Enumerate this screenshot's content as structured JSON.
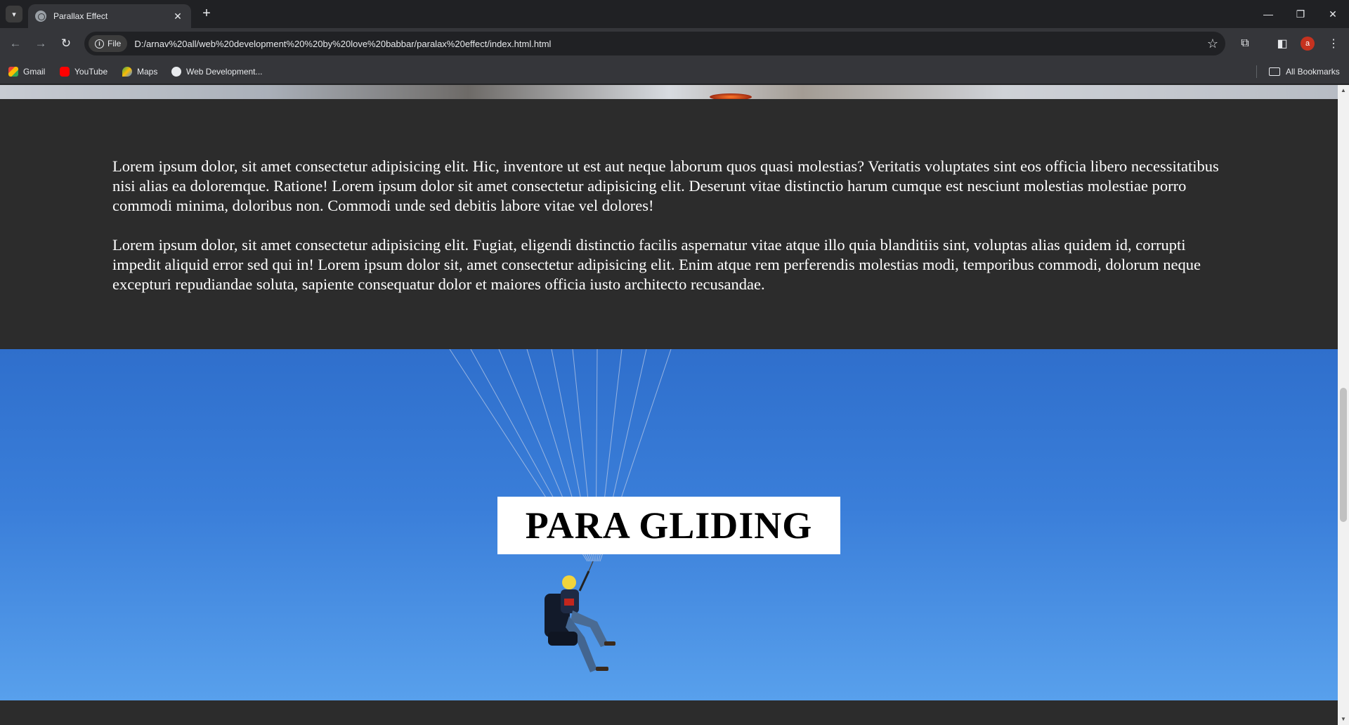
{
  "browser": {
    "tab_title": "Parallax Effect",
    "new_tab_symbol": "+",
    "site_info_label": "File",
    "url": "D:/arnav%20all/web%20development%20%20by%20love%20babbar/paralax%20effect/index.html.html",
    "profile_initial": "a",
    "bookmarks": [
      {
        "label": "Gmail",
        "icon": "gmail-icon"
      },
      {
        "label": "YouTube",
        "icon": "youtube-icon"
      },
      {
        "label": "Maps",
        "icon": "maps-icon"
      },
      {
        "label": "Web Development...",
        "icon": "web-icon"
      }
    ],
    "all_bookmarks_label": "All Bookmarks"
  },
  "page": {
    "paragraphs": [
      "Lorem ipsum dolor, sit amet consectetur adipisicing elit. Hic, inventore ut est aut neque laborum quos quasi molestias? Veritatis voluptates sint eos officia libero necessitatibus nisi alias ea doloremque. Ratione! Lorem ipsum dolor sit amet consectetur adipisicing elit. Deserunt vitae distinctio harum cumque est nesciunt molestias molestiae porro commodi minima, doloribus non. Commodi unde sed debitis labore vitae vel dolores!",
      "Lorem ipsum dolor, sit amet consectetur adipisicing elit. Fugiat, eligendi distinctio facilis aspernatur vitae atque illo quia blanditiis sint, voluptas alias quidem id, corrupti impedit aliquid error sed qui in! Lorem ipsum dolor sit, amet consectetur adipisicing elit. Enim atque rem perferendis molestias modi, temporibus commodi, dolorum neque excepturi repudiandae soluta, sapiente consequatur dolor et maiores officia iusto architecto recusandae."
    ],
    "section_heading": "PARA GLIDING"
  },
  "colors": {
    "page_background": "#2c2c2c",
    "sky_top": "#2f6fcc",
    "sky_bottom": "#58a0ec",
    "heading_box": "#ffffff"
  }
}
